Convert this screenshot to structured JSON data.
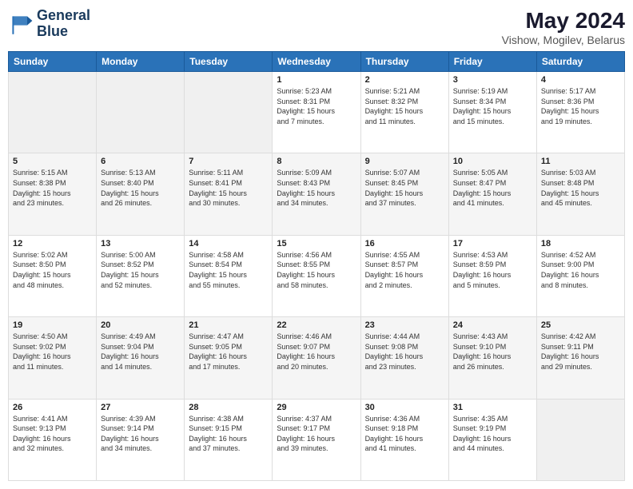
{
  "logo": {
    "line1": "General",
    "line2": "Blue"
  },
  "title": "May 2024",
  "subtitle": "Vishow, Mogilev, Belarus",
  "days_header": [
    "Sunday",
    "Monday",
    "Tuesday",
    "Wednesday",
    "Thursday",
    "Friday",
    "Saturday"
  ],
  "weeks": [
    [
      {
        "day": "",
        "info": ""
      },
      {
        "day": "",
        "info": ""
      },
      {
        "day": "",
        "info": ""
      },
      {
        "day": "1",
        "info": "Sunrise: 5:23 AM\nSunset: 8:31 PM\nDaylight: 15 hours\nand 7 minutes."
      },
      {
        "day": "2",
        "info": "Sunrise: 5:21 AM\nSunset: 8:32 PM\nDaylight: 15 hours\nand 11 minutes."
      },
      {
        "day": "3",
        "info": "Sunrise: 5:19 AM\nSunset: 8:34 PM\nDaylight: 15 hours\nand 15 minutes."
      },
      {
        "day": "4",
        "info": "Sunrise: 5:17 AM\nSunset: 8:36 PM\nDaylight: 15 hours\nand 19 minutes."
      }
    ],
    [
      {
        "day": "5",
        "info": "Sunrise: 5:15 AM\nSunset: 8:38 PM\nDaylight: 15 hours\nand 23 minutes."
      },
      {
        "day": "6",
        "info": "Sunrise: 5:13 AM\nSunset: 8:40 PM\nDaylight: 15 hours\nand 26 minutes."
      },
      {
        "day": "7",
        "info": "Sunrise: 5:11 AM\nSunset: 8:41 PM\nDaylight: 15 hours\nand 30 minutes."
      },
      {
        "day": "8",
        "info": "Sunrise: 5:09 AM\nSunset: 8:43 PM\nDaylight: 15 hours\nand 34 minutes."
      },
      {
        "day": "9",
        "info": "Sunrise: 5:07 AM\nSunset: 8:45 PM\nDaylight: 15 hours\nand 37 minutes."
      },
      {
        "day": "10",
        "info": "Sunrise: 5:05 AM\nSunset: 8:47 PM\nDaylight: 15 hours\nand 41 minutes."
      },
      {
        "day": "11",
        "info": "Sunrise: 5:03 AM\nSunset: 8:48 PM\nDaylight: 15 hours\nand 45 minutes."
      }
    ],
    [
      {
        "day": "12",
        "info": "Sunrise: 5:02 AM\nSunset: 8:50 PM\nDaylight: 15 hours\nand 48 minutes."
      },
      {
        "day": "13",
        "info": "Sunrise: 5:00 AM\nSunset: 8:52 PM\nDaylight: 15 hours\nand 52 minutes."
      },
      {
        "day": "14",
        "info": "Sunrise: 4:58 AM\nSunset: 8:54 PM\nDaylight: 15 hours\nand 55 minutes."
      },
      {
        "day": "15",
        "info": "Sunrise: 4:56 AM\nSunset: 8:55 PM\nDaylight: 15 hours\nand 58 minutes."
      },
      {
        "day": "16",
        "info": "Sunrise: 4:55 AM\nSunset: 8:57 PM\nDaylight: 16 hours\nand 2 minutes."
      },
      {
        "day": "17",
        "info": "Sunrise: 4:53 AM\nSunset: 8:59 PM\nDaylight: 16 hours\nand 5 minutes."
      },
      {
        "day": "18",
        "info": "Sunrise: 4:52 AM\nSunset: 9:00 PM\nDaylight: 16 hours\nand 8 minutes."
      }
    ],
    [
      {
        "day": "19",
        "info": "Sunrise: 4:50 AM\nSunset: 9:02 PM\nDaylight: 16 hours\nand 11 minutes."
      },
      {
        "day": "20",
        "info": "Sunrise: 4:49 AM\nSunset: 9:04 PM\nDaylight: 16 hours\nand 14 minutes."
      },
      {
        "day": "21",
        "info": "Sunrise: 4:47 AM\nSunset: 9:05 PM\nDaylight: 16 hours\nand 17 minutes."
      },
      {
        "day": "22",
        "info": "Sunrise: 4:46 AM\nSunset: 9:07 PM\nDaylight: 16 hours\nand 20 minutes."
      },
      {
        "day": "23",
        "info": "Sunrise: 4:44 AM\nSunset: 9:08 PM\nDaylight: 16 hours\nand 23 minutes."
      },
      {
        "day": "24",
        "info": "Sunrise: 4:43 AM\nSunset: 9:10 PM\nDaylight: 16 hours\nand 26 minutes."
      },
      {
        "day": "25",
        "info": "Sunrise: 4:42 AM\nSunset: 9:11 PM\nDaylight: 16 hours\nand 29 minutes."
      }
    ],
    [
      {
        "day": "26",
        "info": "Sunrise: 4:41 AM\nSunset: 9:13 PM\nDaylight: 16 hours\nand 32 minutes."
      },
      {
        "day": "27",
        "info": "Sunrise: 4:39 AM\nSunset: 9:14 PM\nDaylight: 16 hours\nand 34 minutes."
      },
      {
        "day": "28",
        "info": "Sunrise: 4:38 AM\nSunset: 9:15 PM\nDaylight: 16 hours\nand 37 minutes."
      },
      {
        "day": "29",
        "info": "Sunrise: 4:37 AM\nSunset: 9:17 PM\nDaylight: 16 hours\nand 39 minutes."
      },
      {
        "day": "30",
        "info": "Sunrise: 4:36 AM\nSunset: 9:18 PM\nDaylight: 16 hours\nand 41 minutes."
      },
      {
        "day": "31",
        "info": "Sunrise: 4:35 AM\nSunset: 9:19 PM\nDaylight: 16 hours\nand 44 minutes."
      },
      {
        "day": "",
        "info": ""
      }
    ]
  ]
}
